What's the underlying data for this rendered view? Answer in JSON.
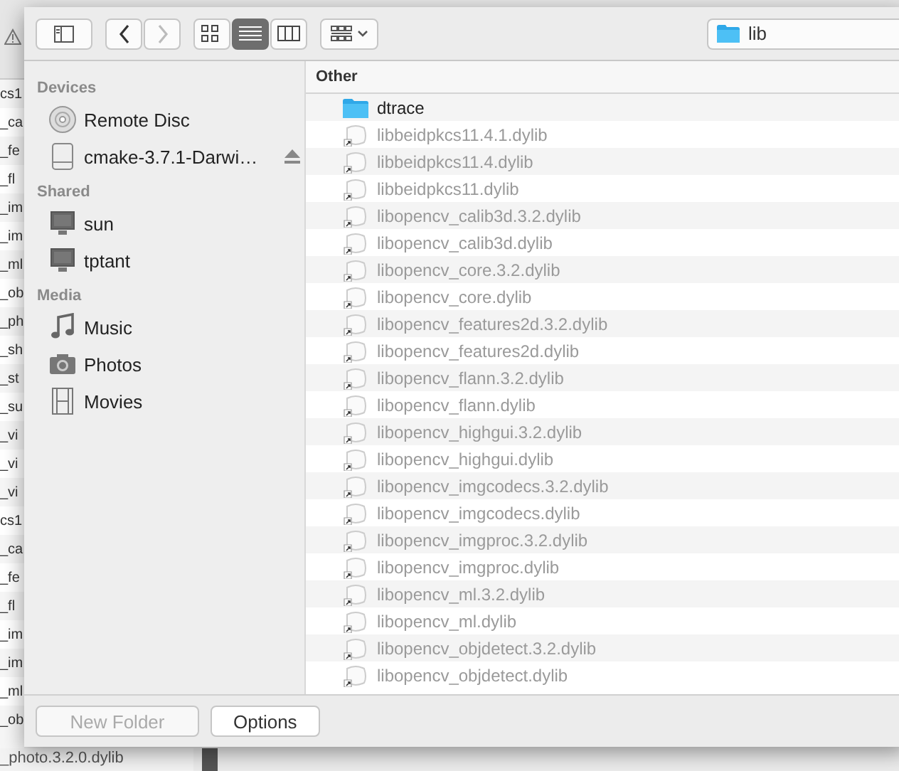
{
  "background_window": {
    "fragments": [
      "cs1",
      "_ca",
      "_fe",
      "_fl",
      "_im",
      "_im",
      "_ml",
      "_ob",
      "_ph",
      "_sh",
      "_st",
      "_su",
      "_vi",
      "_vi",
      "_vi",
      "cs1",
      "_ca",
      "_fe",
      "_fl",
      "_im",
      "_im",
      "_ml",
      "_ob"
    ],
    "last_row": "_photo.3.2.0.dylib"
  },
  "dialog": {
    "toolbar": {
      "nav": [
        {
          "kind": "back",
          "disabled": false
        },
        {
          "kind": "forward",
          "disabled": true
        }
      ],
      "view_modes": [
        {
          "kind": "icons",
          "selected": false
        },
        {
          "kind": "list",
          "selected": true
        },
        {
          "kind": "columns",
          "selected": false
        }
      ],
      "location": "lib"
    },
    "sidebar": {
      "sections": [
        {
          "title": "Devices",
          "items": [
            {
              "label": "Remote Disc",
              "kind": "disc",
              "ejectable": false
            },
            {
              "label": "cmake-3.7.1-Darwi…",
              "kind": "drive",
              "ejectable": true
            }
          ]
        },
        {
          "title": "Shared",
          "items": [
            {
              "label": "sun",
              "kind": "computer",
              "ejectable": false
            },
            {
              "label": "tptant",
              "kind": "computer",
              "ejectable": false
            }
          ]
        },
        {
          "title": "Media",
          "items": [
            {
              "label": "Music",
              "kind": "music",
              "ejectable": false
            },
            {
              "label": "Photos",
              "kind": "camera",
              "ejectable": false
            },
            {
              "label": "Movies",
              "kind": "film",
              "ejectable": false
            }
          ]
        }
      ]
    },
    "list": {
      "header": "Other",
      "rows": [
        {
          "name": "dtrace",
          "kind": "folder"
        },
        {
          "name": "libbeidpkcs11.4.1.dylib",
          "kind": "alias"
        },
        {
          "name": "libbeidpkcs11.4.dylib",
          "kind": "alias"
        },
        {
          "name": "libbeidpkcs11.dylib",
          "kind": "alias"
        },
        {
          "name": "libopencv_calib3d.3.2.dylib",
          "kind": "alias"
        },
        {
          "name": "libopencv_calib3d.dylib",
          "kind": "alias"
        },
        {
          "name": "libopencv_core.3.2.dylib",
          "kind": "alias"
        },
        {
          "name": "libopencv_core.dylib",
          "kind": "alias"
        },
        {
          "name": "libopencv_features2d.3.2.dylib",
          "kind": "alias"
        },
        {
          "name": "libopencv_features2d.dylib",
          "kind": "alias"
        },
        {
          "name": "libopencv_flann.3.2.dylib",
          "kind": "alias"
        },
        {
          "name": "libopencv_flann.dylib",
          "kind": "alias"
        },
        {
          "name": "libopencv_highgui.3.2.dylib",
          "kind": "alias"
        },
        {
          "name": "libopencv_highgui.dylib",
          "kind": "alias"
        },
        {
          "name": "libopencv_imgcodecs.3.2.dylib",
          "kind": "alias"
        },
        {
          "name": "libopencv_imgcodecs.dylib",
          "kind": "alias"
        },
        {
          "name": "libopencv_imgproc.3.2.dylib",
          "kind": "alias"
        },
        {
          "name": "libopencv_imgproc.dylib",
          "kind": "alias"
        },
        {
          "name": "libopencv_ml.3.2.dylib",
          "kind": "alias"
        },
        {
          "name": "libopencv_ml.dylib",
          "kind": "alias"
        },
        {
          "name": "libopencv_objdetect.3.2.dylib",
          "kind": "alias"
        },
        {
          "name": "libopencv_objdetect.dylib",
          "kind": "alias"
        }
      ]
    },
    "buttons": [
      {
        "label": "New Folder",
        "disabled": true
      },
      {
        "label": "Options",
        "disabled": false
      }
    ]
  }
}
